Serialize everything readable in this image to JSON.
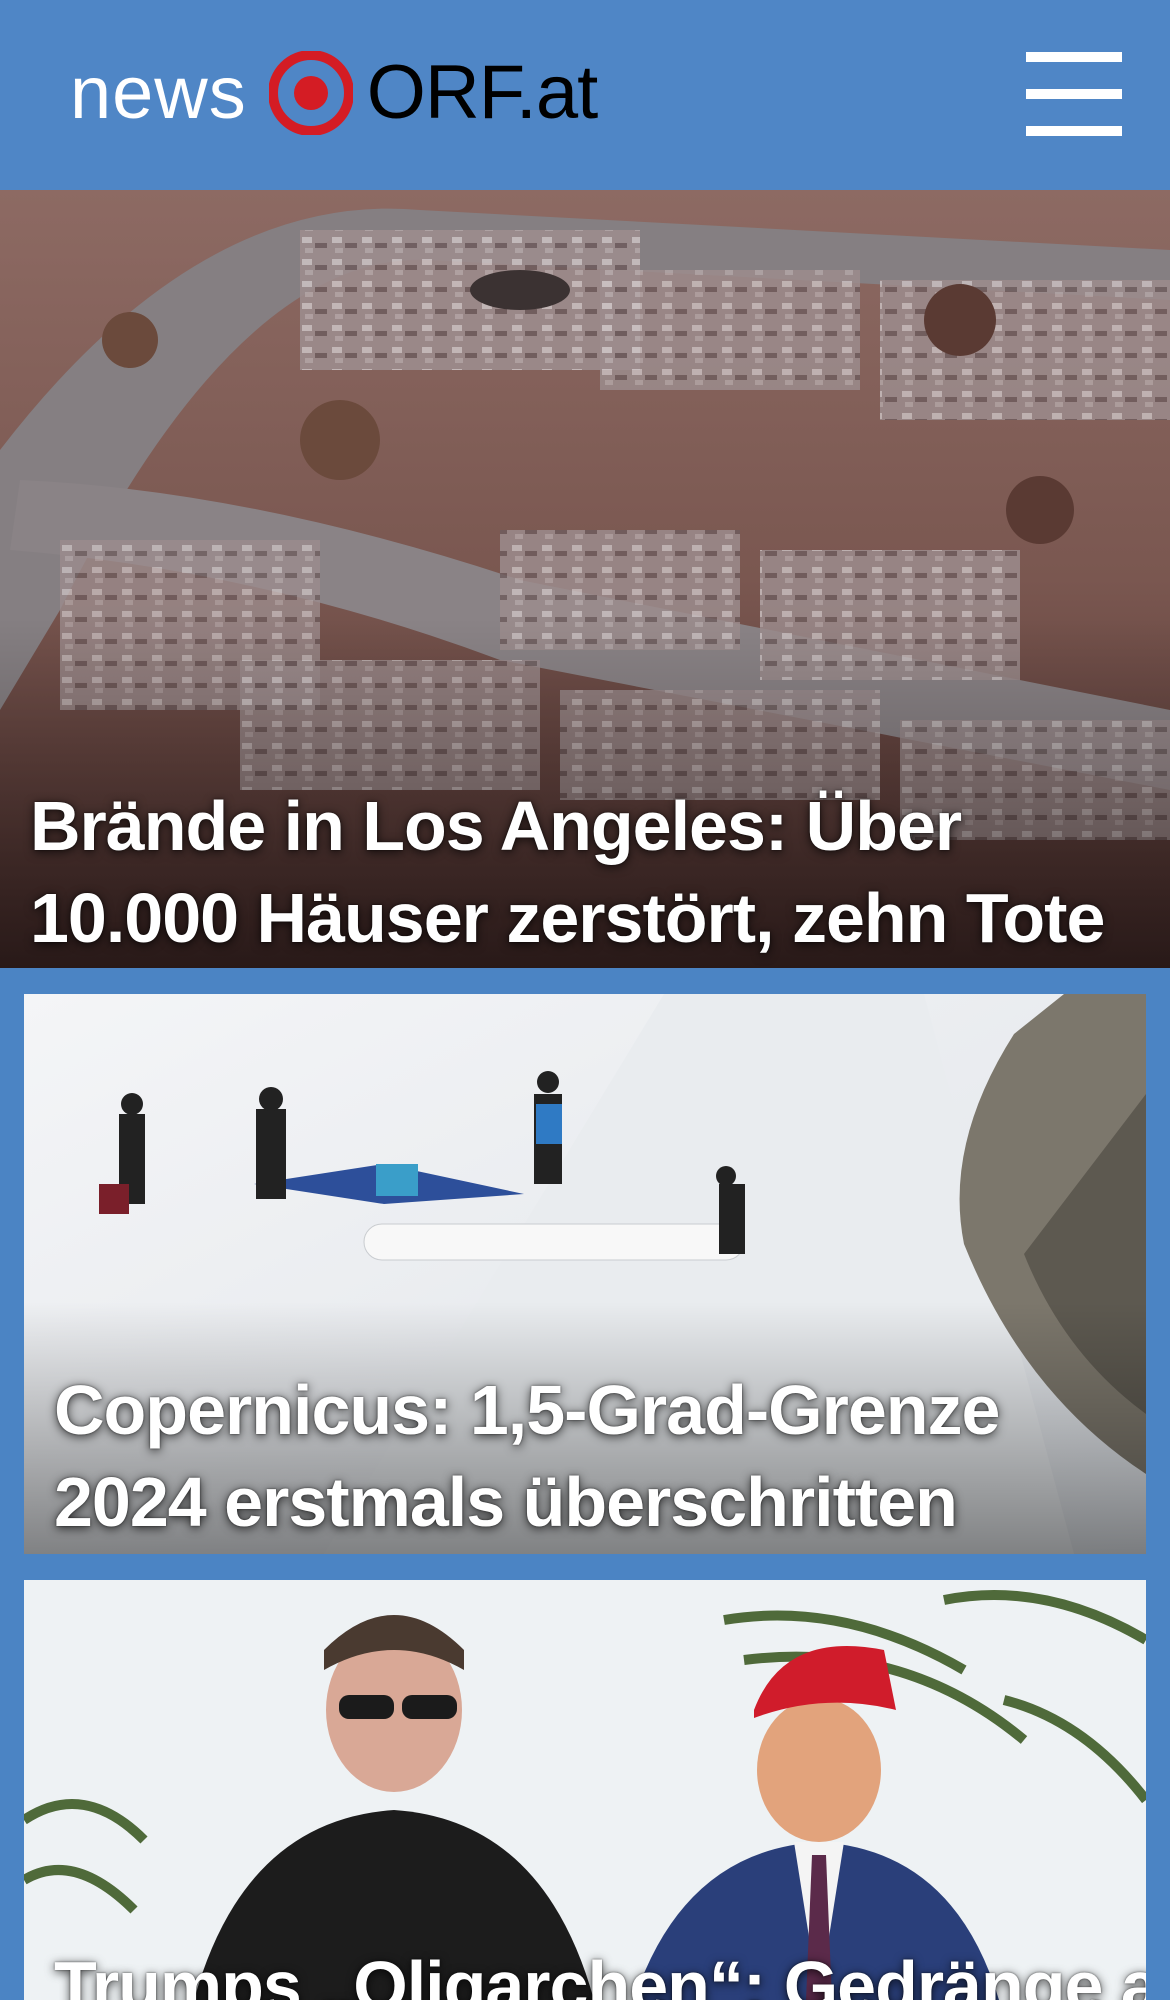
{
  "header": {
    "logo_news": "news",
    "logo_orf": "ORF.at",
    "logo_color": "#d41c24",
    "background": "#4f86c6",
    "menu_icon": "hamburger-menu-icon"
  },
  "stories": [
    {
      "title": "Brände in Los Angeles: Über 10.000 Häuser zerstört, zehn Tote",
      "image": "aerial view of burned-out neighborhood"
    },
    {
      "title": "Copernicus: 1,5-Grad-Grenze 2024 erstmals überschritten",
      "image": "workers rolling white fabric over glacier snow"
    },
    {
      "title": "Trumps „Oligarchen“: Gedränge auf",
      "image": "Elon Musk and Donald Trump portraits"
    }
  ]
}
